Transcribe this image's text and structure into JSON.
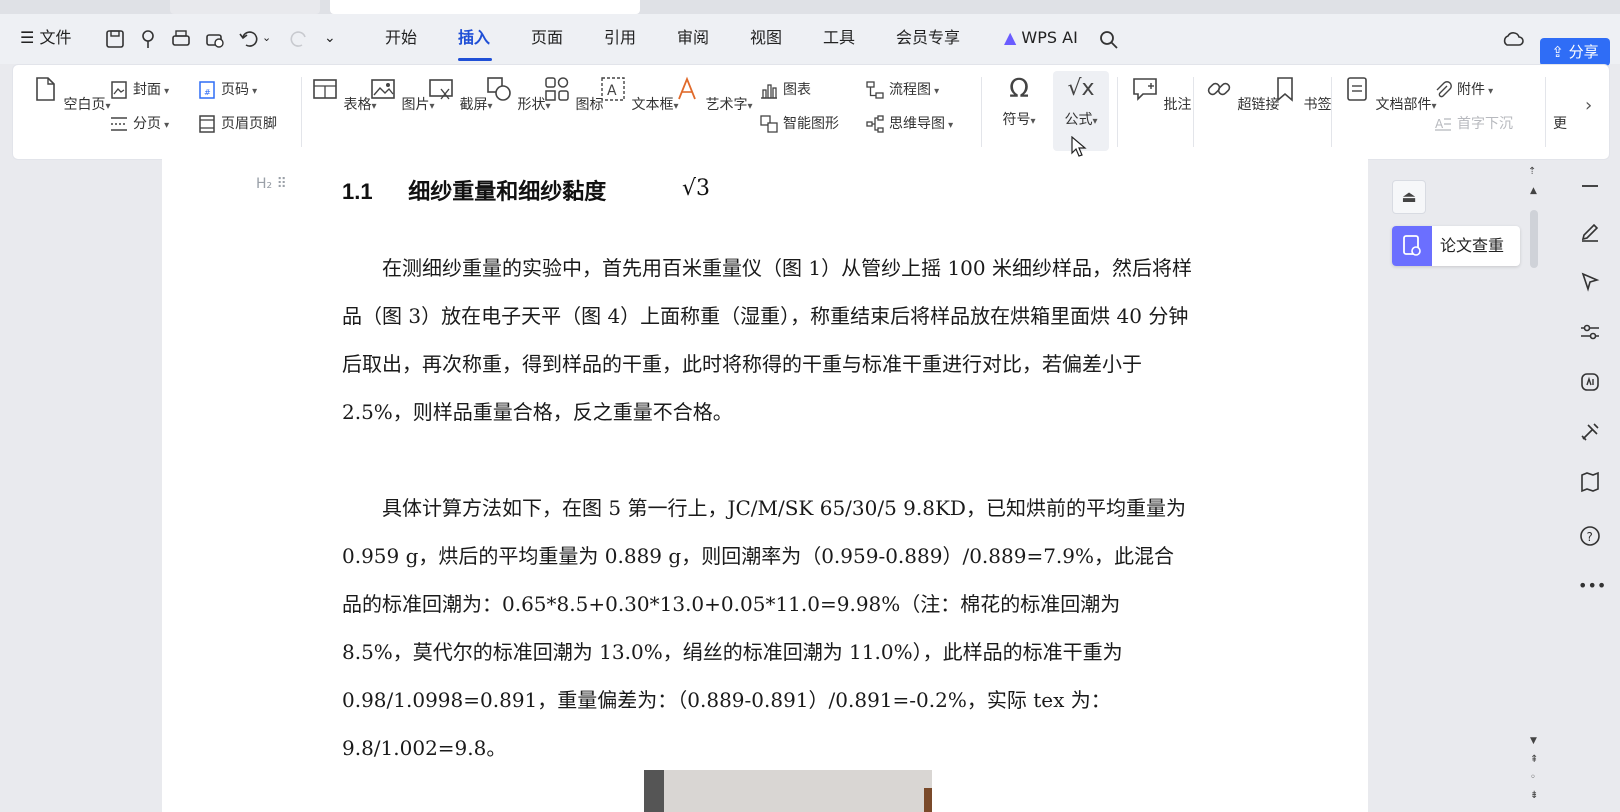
{
  "menubar": {
    "file": "文件",
    "tabs": [
      {
        "label": "开始"
      },
      {
        "label": "插入"
      },
      {
        "label": "页面"
      },
      {
        "label": "引用"
      },
      {
        "label": "审阅"
      },
      {
        "label": "视图"
      },
      {
        "label": "工具"
      },
      {
        "label": "会员专享"
      }
    ],
    "wps_ai": "WPS AI",
    "share": "分享"
  },
  "ribbon": {
    "blank_page": "空白页",
    "cover": "封面",
    "page_break": "分页",
    "page_number": "页码",
    "header_footer": "页眉页脚",
    "table": "表格",
    "picture": "图片",
    "screenshot": "截屏",
    "shape": "形状",
    "icon": "图标",
    "textbox": "文本框",
    "wordart": "艺术字",
    "chart": "图表",
    "smart_graphic": "智能图形",
    "flowchart": "流程图",
    "mindmap": "思维导图",
    "symbol": "符号",
    "formula": "公式",
    "comment": "批注",
    "hyperlink": "超链接",
    "bookmark": "书签",
    "attachment": "附件",
    "doc_parts": "文档部件",
    "first_drop": "首字下沉",
    "more": "更"
  },
  "document": {
    "heading_number": "1.1",
    "heading_text": "细纱重量和细纱黏度",
    "sqrt_symbol": "√3",
    "para1": "在测细纱重量的实验中，首先用百米重量仪（图 1）从管纱上摇 100 米细纱样品，然后将样品（图 3）放在电子天平（图 4）上面称重（湿重），称重结束后将样品放在烘箱里面烘 40 分钟后取出，再次称重，得到样品的干重，此时将称得的干重与标准干重进行对比，若偏差小于 2.5%，则样品重量合格，反之重量不合格。",
    "para2": "具体计算方法如下，在图 5 第一行上，JC/M/SK 65/30/5 9.8KD，已知烘前的平均重量为 0.959 g，烘后的平均重量为 0.889 g，则回潮率为（0.959-0.889）/0.889=7.9%，此混合品的标准回潮为：0.65*8.5+0.30*13.0+0.05*11.0=9.98%（注：棉花的标准回潮为 8.5%，莫代尔的标准回潮为 13.0%，绢丝的标准回潮为 11.0%），此样品的标准干重为 0.98/1.0998=0.891，重量偏差为：（0.889-0.891）/0.891=-0.2%，实际 tex 为：9.8/1.002=9.8。"
  },
  "right_panel": {
    "paper_check": "论文查重"
  },
  "colors": {
    "accent": "#1f4fd6",
    "share_button": "#2f6df6",
    "panel_icon": "#6b6fff"
  }
}
